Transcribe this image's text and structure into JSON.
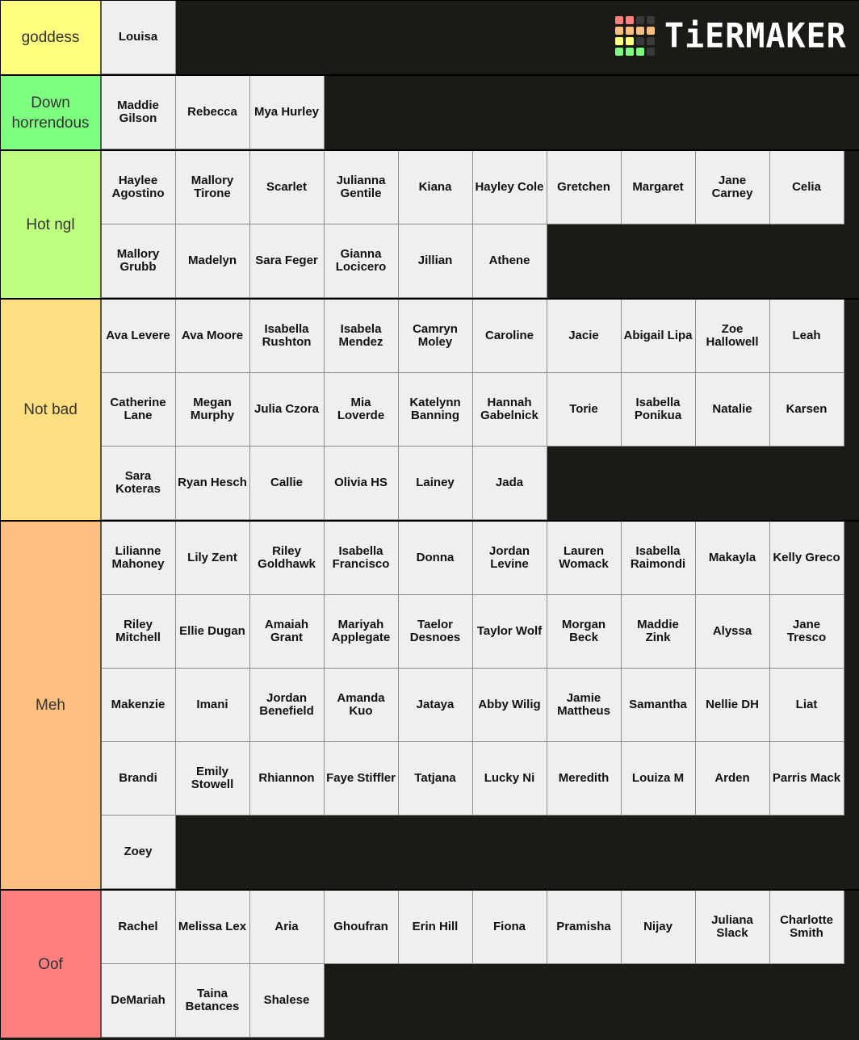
{
  "branding": {
    "logo_text": "TiERMAKER",
    "logo_grid_colors": [
      "#ff7f7f",
      "#ff7f7f",
      "#3a3a3a",
      "#3a3a3a",
      "#ffbf7f",
      "#ffbf7f",
      "#ffbf7f",
      "#ffbf7f",
      "#ffff7f",
      "#ffff7f",
      "#3a3a3a",
      "#3a3a3a",
      "#7fff7f",
      "#7fff7f",
      "#7fff7f",
      "#3a3a3a"
    ]
  },
  "colors": {
    "background": "#1a1a17",
    "item_background": "#efefef"
  },
  "tiers": [
    {
      "label": "goddess",
      "color": "#ffff7f",
      "items": [
        "Louisa"
      ]
    },
    {
      "label": "Down horrendous",
      "color": "#7fff7f",
      "items": [
        "Maddie Gilson",
        "Rebecca",
        "Mya Hurley"
      ]
    },
    {
      "label": "Hot ngl",
      "color": "#bfff7f",
      "items": [
        "Haylee Agostino",
        "Mallory Tirone",
        "Scarlet",
        "Julianna Gentile",
        "Kiana",
        "Hayley Cole",
        "Gretchen",
        "Margaret",
        "Jane Carney",
        "Celia",
        "Mallory Grubb",
        "Madelyn",
        "Sara Feger",
        "Gianna Locicero",
        "Jillian",
        "Athene"
      ]
    },
    {
      "label": "Not bad",
      "color": "#ffdf7f",
      "items": [
        "Ava Levere",
        "Ava Moore",
        "Isabella Rushton",
        "Isabela Mendez",
        "Camryn Moley",
        "Caroline",
        "Jacie",
        "Abigail Lipa",
        "Zoe Hallowell",
        "Leah",
        "Catherine Lane",
        "Megan Murphy",
        "Julia Czora",
        "Mia Loverde",
        "Katelynn Banning",
        "Hannah Gabelnick",
        "Torie",
        "Isabella Ponikua",
        "Natalie",
        "Karsen",
        "Sara Koteras",
        "Ryan Hesch",
        "Callie",
        "Olivia HS",
        "Lainey",
        "Jada"
      ]
    },
    {
      "label": "Meh",
      "color": "#ffbf7f",
      "items": [
        "Lilianne Mahoney",
        "Lily Zent",
        "Riley Goldhawk",
        "Isabella Francisco",
        "Donna",
        "Jordan Levine",
        "Lauren Womack",
        "Isabella Raimondi",
        "Makayla",
        "Kelly Greco",
        "Riley Mitchell",
        "Ellie Dugan",
        "Amaiah Grant",
        "Mariyah Applegate",
        "Taelor Desnoes",
        "Taylor Wolf",
        "Morgan Beck",
        "Maddie Zink",
        "Alyssa",
        "Jane Tresco",
        "Makenzie",
        "Imani",
        "Jordan Benefield",
        "Amanda Kuo",
        "Jataya",
        "Abby Wilig",
        "Jamie Mattheus",
        "Samantha",
        "Nellie DH",
        "Liat",
        "Brandi",
        "Emily Stowell",
        "Rhiannon",
        "Faye Stiffler",
        "Tatjana",
        "Lucky Ni",
        "Meredith",
        "Louiza M",
        "Arden",
        "Parris Mack",
        "Zoey"
      ]
    },
    {
      "label": "Oof",
      "color": "#ff7f7f",
      "items": [
        "Rachel",
        "Melissa Lex",
        "Aria",
        "Ghoufran",
        "Erin Hill",
        "Fiona",
        "Pramisha",
        "Nijay",
        "Juliana Slack",
        "Charlotte Smith",
        "DeMariah",
        "Taina Betances",
        "Shalese"
      ]
    }
  ]
}
